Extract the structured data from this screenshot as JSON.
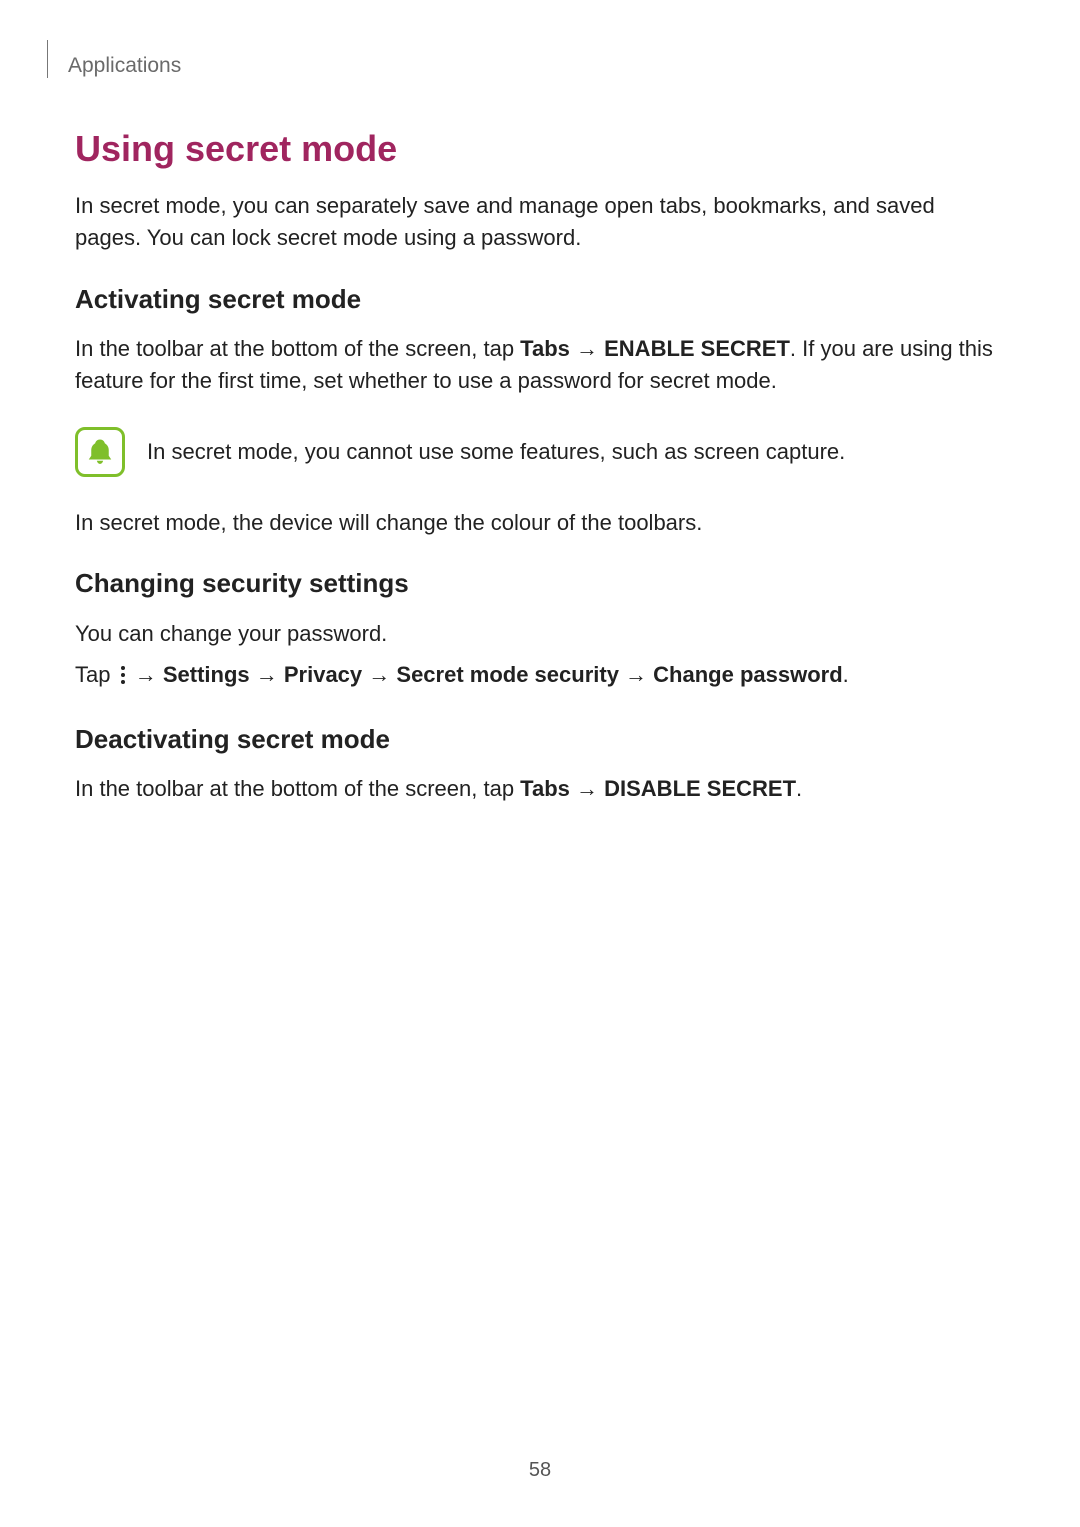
{
  "breadcrumb": "Applications",
  "heading": "Using secret mode",
  "intro": "In secret mode, you can separately save and manage open tabs, bookmarks, and saved pages. You can lock secret mode using a password.",
  "sec1": {
    "title": "Activating secret mode",
    "pre": "In the toolbar at the bottom of the screen, tap ",
    "tabs": "Tabs",
    "arrow": " → ",
    "enable": "ENABLE SECRET",
    "post": ". If you are using this feature for the first time, set whether to use a password for secret mode.",
    "note": "In secret mode, you cannot use some features, such as screen capture.",
    "after_note": "In secret mode, the device will change the colour of the toolbars."
  },
  "sec2": {
    "title": "Changing security settings",
    "line1": "You can change your password.",
    "tap": "Tap ",
    "settings": "Settings",
    "privacy": "Privacy",
    "sms": "Secret mode security",
    "cp": "Change password",
    "period": "."
  },
  "sec3": {
    "title": "Deactivating secret mode",
    "pre": "In the toolbar at the bottom of the screen, tap ",
    "tabs": "Tabs",
    "arrow": " → ",
    "disable": "DISABLE SECRET",
    "post": "."
  },
  "page_number": "58"
}
